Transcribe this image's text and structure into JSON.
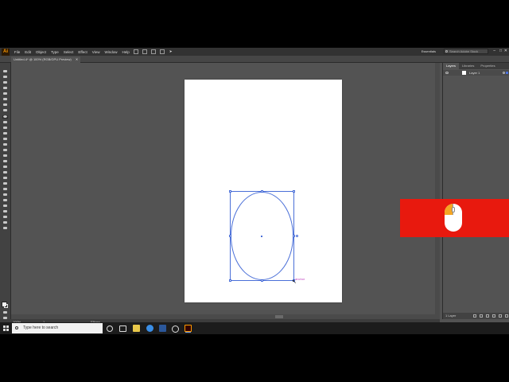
{
  "app": {
    "logo": "Ai"
  },
  "menu": {
    "items": [
      "File",
      "Edit",
      "Object",
      "Type",
      "Select",
      "Effect",
      "View",
      "Window",
      "Help"
    ],
    "workspace": "Essentials",
    "search_placeholder": "Search Adobe Stock"
  },
  "window_controls": {
    "minimize": "–",
    "maximize": "□",
    "close": "✕"
  },
  "document": {
    "tab_title": "Untitled-4* @ 100% (RGB/GPU Preview)",
    "close": "✕"
  },
  "canvas": {
    "anchor_label": "anchor",
    "cursor": "↖"
  },
  "panel": {
    "tabs": [
      "Layers",
      "Libraries",
      "Properties"
    ],
    "layer_name": "Layer 1",
    "layers_count": "1 Layer"
  },
  "status": {
    "zoom": "100%",
    "artboard": "1",
    "tool": "Ellipse"
  },
  "taskbar": {
    "search_placeholder": "Type here to search"
  },
  "colors": {
    "accent": "#4a6fd8",
    "overlay": "#e8190e",
    "mouse_button": "#f5a623",
    "ai_orange": "#ff9a00"
  }
}
